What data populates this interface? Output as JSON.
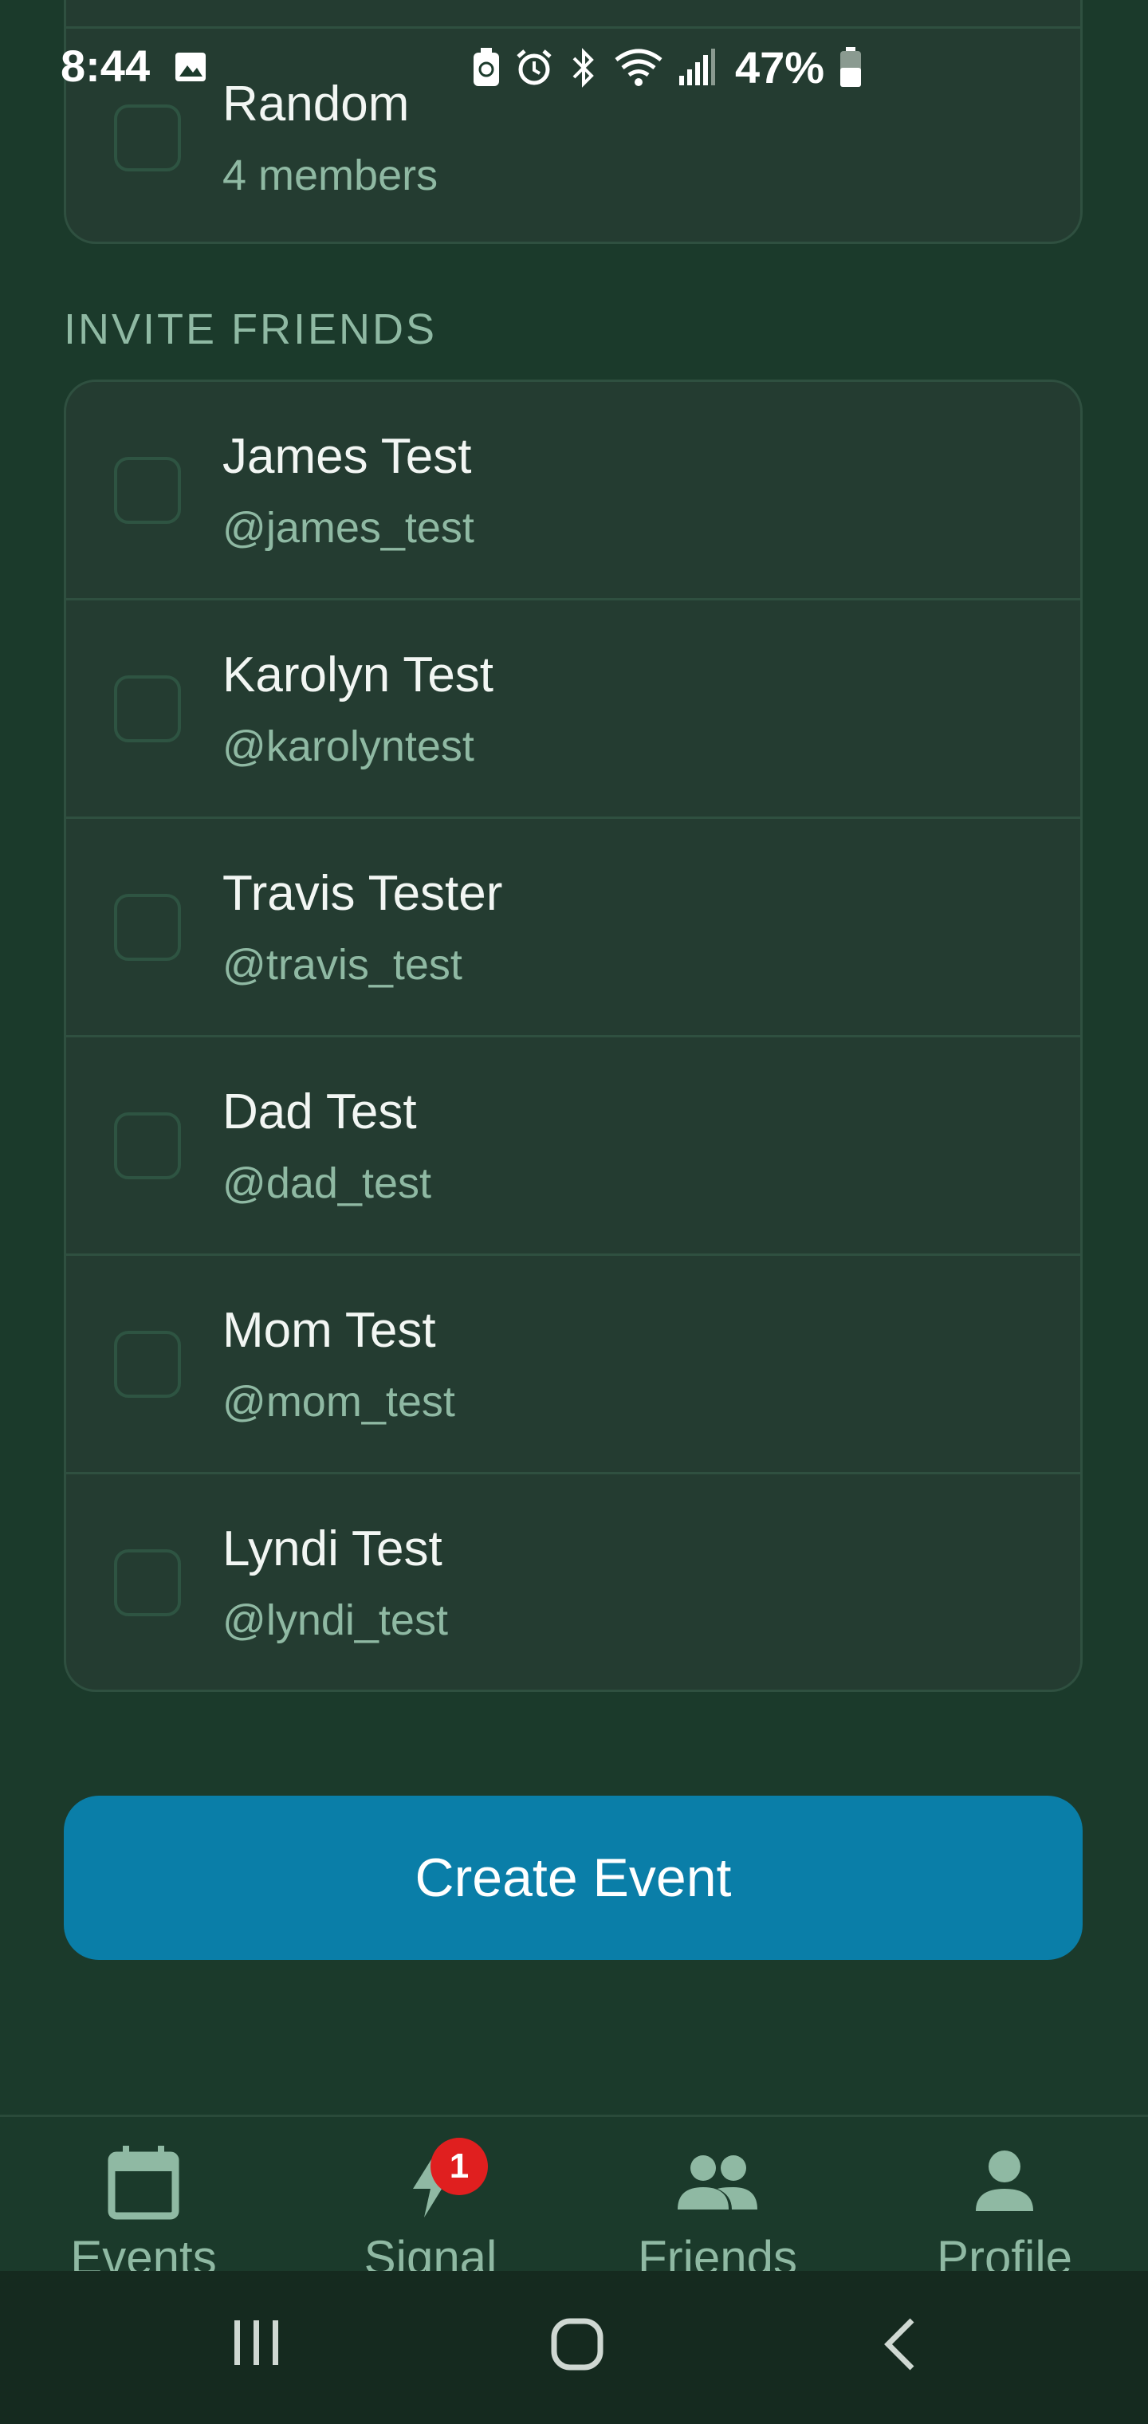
{
  "status_bar": {
    "time": "8:44",
    "battery": "47%",
    "icons": [
      "gallery-icon",
      "battery-saver-icon",
      "alarm-icon",
      "bluetooth-icon",
      "wifi-icon",
      "signal-icon",
      "battery-icon"
    ]
  },
  "groups": [
    {
      "name": "Random",
      "members": "4 members",
      "checked": false
    }
  ],
  "invite_section": {
    "label": "INVITE FRIENDS",
    "friends": [
      {
        "name": "James Test",
        "handle": "@james_test",
        "checked": false
      },
      {
        "name": "Karolyn Test",
        "handle": "@karolyntest",
        "checked": false
      },
      {
        "name": "Travis Tester",
        "handle": "@travis_test",
        "checked": false
      },
      {
        "name": "Dad Test",
        "handle": "@dad_test",
        "checked": false
      },
      {
        "name": "Mom Test",
        "handle": "@mom_test",
        "checked": false
      },
      {
        "name": "Lyndi Test",
        "handle": "@lyndi_test",
        "checked": false
      }
    ]
  },
  "create_button": {
    "label": "Create Event"
  },
  "tabs": [
    {
      "label": "Events",
      "icon": "calendar-icon"
    },
    {
      "label": "Signal",
      "icon": "bolt-icon",
      "badge": "1"
    },
    {
      "label": "Friends",
      "icon": "people-icon"
    },
    {
      "label": "Profile",
      "icon": "person-icon"
    }
  ],
  "nav_bar": {
    "icons": [
      "recent-apps-icon",
      "home-icon",
      "back-icon"
    ]
  },
  "colors": {
    "background": "#1b3a2b",
    "card": "#243c31",
    "accent_button": "#0a7ea8",
    "muted_text": "#8fb9a3",
    "badge": "#e01f1f"
  }
}
